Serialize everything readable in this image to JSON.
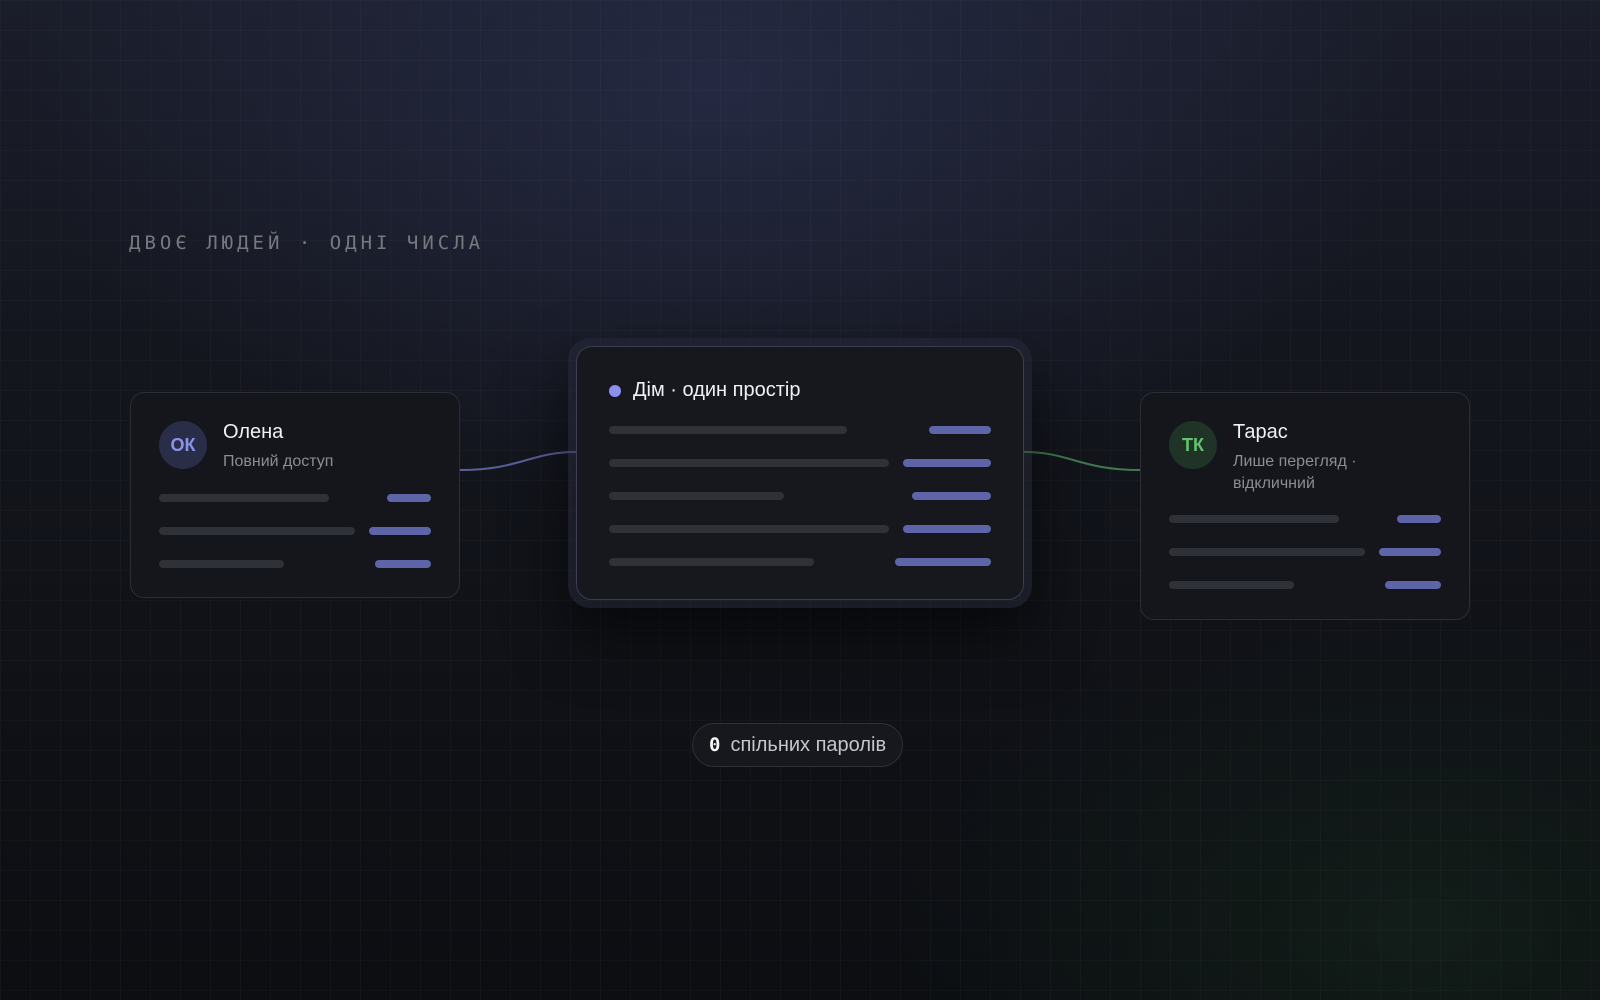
{
  "headline": "ДВОЄ ЛЮДЕЙ · ОДНІ ЧИСЛА",
  "colors": {
    "accent_purple": "#8a90ee",
    "accent_green": "#63c26f",
    "bar_accent": "#5e64a8",
    "bar_muted": "#2f3138"
  },
  "members": [
    {
      "initials": "ОК",
      "name": "Олена",
      "role": "Повний доступ",
      "color": "purple"
    },
    {
      "initials": "ТК",
      "name": "Тарас",
      "role": "Лише перегляд · відкличний",
      "color": "green"
    }
  ],
  "space": {
    "title": "Дім · один простір"
  },
  "summary": {
    "count": "0",
    "label": "спільних паролів"
  }
}
